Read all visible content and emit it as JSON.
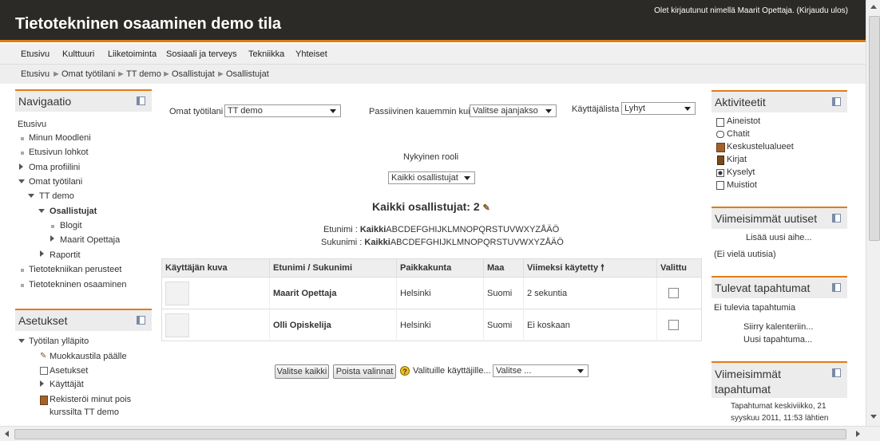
{
  "header": {
    "title": "Tietotekninen osaaminen demo tila",
    "login_info": "Olet kirjautunut nimellä Maarit Opettaja. (Kirjaudu ulos)"
  },
  "nav": [
    "Etusivu",
    "Kulttuuri",
    "Liiketoiminta",
    "Sosiaali ja terveys",
    "Tekniikka",
    "Yhteiset"
  ],
  "breadcrumb": [
    "Etusivu",
    "Omat työtilani",
    "TT demo",
    "Osallistujat",
    "Osallistujat"
  ],
  "navigation_block": {
    "title": "Navigaatio",
    "items": {
      "home": "Etusivu",
      "my_moodle": "Minun Moodleni",
      "site_blocks": "Etusivun lohkot",
      "profile": "Oma profiilini",
      "my_courses": "Omat työtilani",
      "tt_demo": "TT demo",
      "participants": "Osallistujat",
      "blogs": "Blogit",
      "maarit": "Maarit Opettaja",
      "reports": "Raportit",
      "basics": "Tietotekniikan perusteet",
      "skills": "Tietotekninen osaaminen"
    }
  },
  "settings_block": {
    "title": "Asetukset",
    "items": {
      "admin": "Työtilan ylläpito",
      "edit_on": "Muokkaustila päälle",
      "settings": "Asetukset",
      "users": "Käyttäjät",
      "unenrol_line1": "Rekisteröi minut pois",
      "unenrol_line2": "kurssilta TT demo"
    }
  },
  "filters": {
    "my_courses_label": "Omat työtilani",
    "my_courses_value": "TT demo",
    "inactive_label": "Passiivinen kauemmin kuin",
    "inactive_value": "Valitse ajanjakso",
    "userlist_label": "Käyttäjälista",
    "userlist_value": "Lyhyt",
    "role_label": "Nykyinen rooli",
    "role_value": "Kaikki osallistujat"
  },
  "participants": {
    "heading": "Kaikki osallistujat: 2",
    "firstname_label": "Etunimi :",
    "lastname_label": "Sukunimi :",
    "all": "Kaikki",
    "letters": "ABCDEFGHIJKLMNOPQRSTUVWXYZÅÄÖ",
    "columns": [
      "Käyttäjän kuva",
      "Etunimi / Sukunimi",
      "Paikkakunta",
      "Maa",
      "Viimeksi käytetty",
      "Valittu"
    ],
    "rows": [
      {
        "name": "Maarit Opettaja",
        "city": "Helsinki",
        "country": "Suomi",
        "last": "2 sekuntia"
      },
      {
        "name": "Olli Opiskelija",
        "city": "Helsinki",
        "country": "Suomi",
        "last": "Ei koskaan"
      }
    ]
  },
  "actions": {
    "select_all": "Valitse kaikki",
    "deselect": "Poista valinnat",
    "for_selected": "Valituille käyttäjille...",
    "choose": "Valitse ..."
  },
  "activities_block": {
    "title": "Aktiviteetit",
    "items": [
      "Aineistot",
      "Chatit",
      "Keskustelualueet",
      "Kirjat",
      "Kyselyt",
      "Muistiot"
    ]
  },
  "news_block": {
    "title": "Viimeisimmät uutiset",
    "add": "Lisää uusi aihe...",
    "empty": "(Ei vielä uutisia)"
  },
  "upcoming_block": {
    "title": "Tulevat tapahtumat",
    "empty": "Ei tulevia tapahtumia",
    "calendar": "Siirry kalenteriin...",
    "new_event": "Uusi tapahtuma..."
  },
  "recent_block": {
    "title_line1": "Viimeisimmät",
    "title_line2": "tapahtumat",
    "text_line1": "Tapahtumat keskiviikko, 21",
    "text_line2": "syyskuu 2011, 11:53 lähtien"
  },
  "colors": {
    "header_bg": "#2b2a27",
    "accent": "#e07c18"
  }
}
